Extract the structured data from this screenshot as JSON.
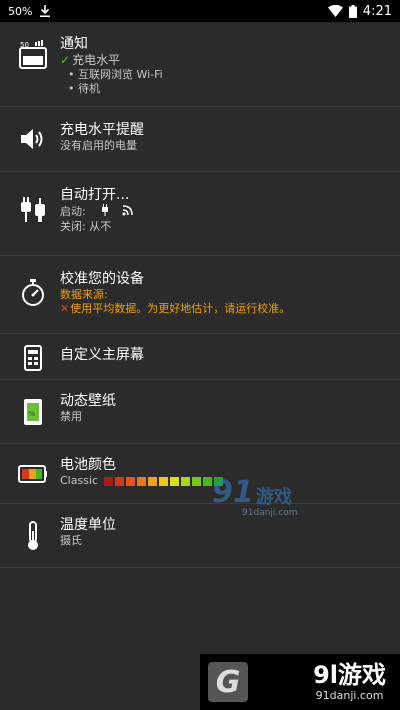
{
  "status_bar": {
    "battery_text": "50%",
    "download_icon": "download-icon",
    "wifi_icon": "wifi-icon",
    "battery_icon": "battery-icon",
    "time": "4:21"
  },
  "items": [
    {
      "icon": "battery-notification-icon",
      "icon_text": "50",
      "title": "通知",
      "checked_option": "充电水平",
      "bullets": [
        "• 互联网浏览 Wi-Fi",
        "• 待机"
      ]
    },
    {
      "icon": "speaker-icon",
      "title": "充电水平提醒",
      "subtitle": "没有启用的电量"
    },
    {
      "icon": "plug-icon",
      "title": "自动打开...",
      "on_label": "启动:",
      "off_label": "关闭: 从不"
    },
    {
      "icon": "stopwatch-icon",
      "title": "校准您的设备",
      "data_source_label": "数据来源:",
      "warning": "使用平均数据。为更好地估计，请运行校准。"
    },
    {
      "icon": "phone-icon",
      "title": "自定义主屏幕"
    },
    {
      "icon": "live-wallpaper-icon",
      "title": "动态壁纸",
      "subtitle": "禁用"
    },
    {
      "icon": "battery-color-icon",
      "title": "电池颜色",
      "subtitle": "Classic",
      "color_segments": [
        "#b01a1a",
        "#d03a1a",
        "#e0561a",
        "#e87a1a",
        "#f0a21a",
        "#f0c81a",
        "#d8e01a",
        "#a8d81a",
        "#78c81a",
        "#48b81a",
        "#20a820"
      ]
    },
    {
      "icon": "thermometer-icon",
      "title": "温度单位",
      "subtitle": "摄氏"
    }
  ],
  "watermark": {
    "mid_big": "91",
    "mid_cn": "游戏",
    "mid_url": "91danji.com",
    "bottom_letter": "G",
    "bottom_brand": "9l游戏",
    "bottom_url": "91danji.com"
  }
}
